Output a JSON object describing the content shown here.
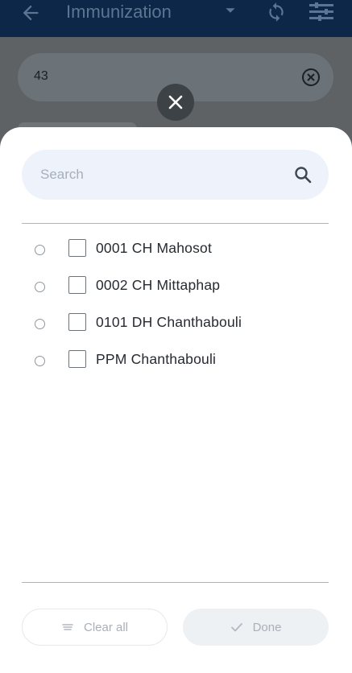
{
  "appbar": {
    "title": "Immunization"
  },
  "background_field": {
    "value": "43"
  },
  "sheet": {
    "search": {
      "placeholder": "Search"
    },
    "items": [
      {
        "label": "0001 CH Mahosot"
      },
      {
        "label": "0002 CH Mittaphap"
      },
      {
        "label": "0101 DH Chanthabouli"
      },
      {
        "label": "PPM Chanthabouli"
      }
    ],
    "buttons": {
      "clear_all": "Clear all",
      "done": "Done"
    }
  },
  "colors": {
    "appbar": "#0d2748",
    "scrim": "#5f6265",
    "search_bg": "#eef3fb",
    "text": "#262b31",
    "muted": "#a9b0b8"
  }
}
